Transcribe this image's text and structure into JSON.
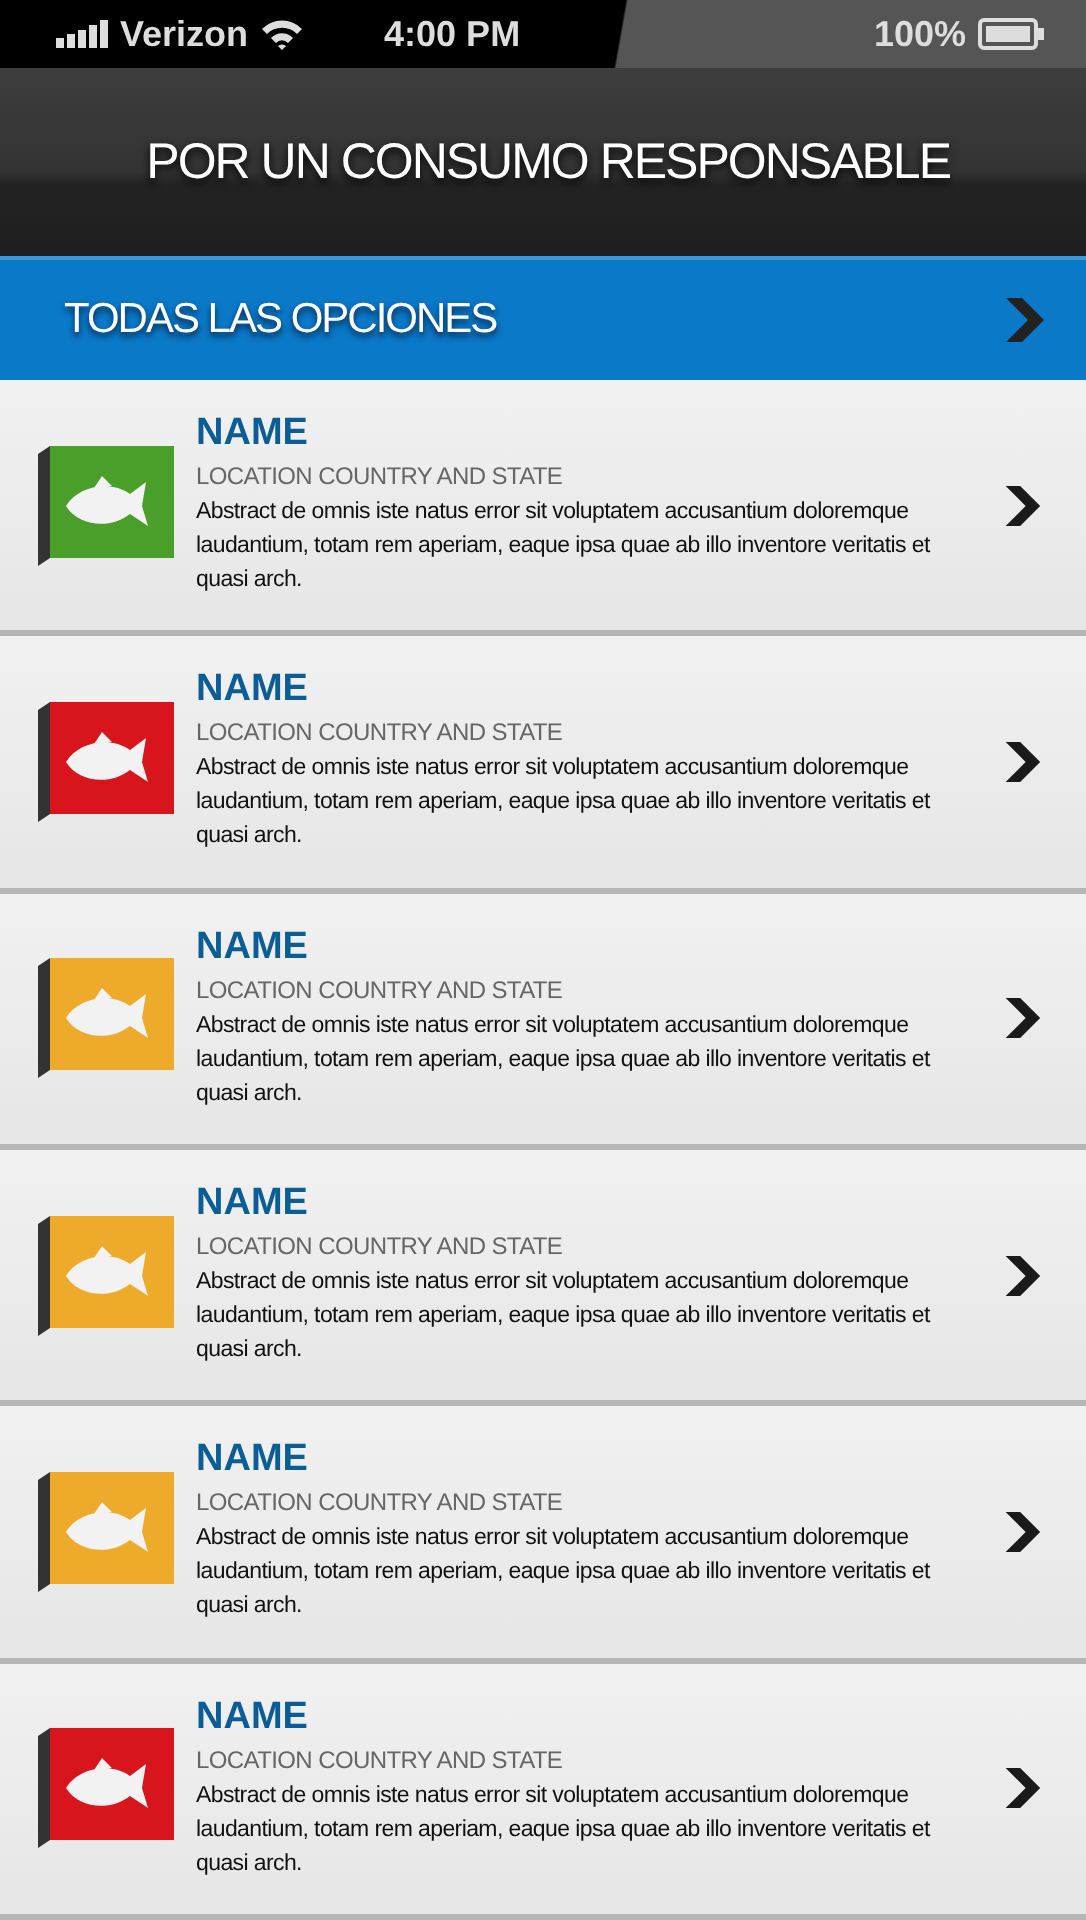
{
  "status_bar": {
    "carrier": "Verizon",
    "time": "4:00 PM",
    "battery": "100%"
  },
  "header": {
    "title": "POR UN CONSUMO RESPONSABLE"
  },
  "all_options": {
    "label": "TODAS LAS OPCIONES"
  },
  "items": [
    {
      "name": "NAME",
      "location": "LOCATION COUNTRY AND STATE",
      "description": "Abstract de omnis iste natus error sit voluptatem accusantium doloremque laudantium, totam rem aperiam, eaque ipsa quae ab illo inventore veritatis et quasi arch.",
      "color": "#4a9e2a"
    },
    {
      "name": "NAME",
      "location": "LOCATION COUNTRY AND STATE",
      "description": "Abstract de omnis iste natus error sit voluptatem accusantium doloremque laudantium, totam rem aperiam, eaque ipsa quae ab illo inventore veritatis et quasi arch.",
      "color": "#d8141c"
    },
    {
      "name": "NAME",
      "location": "LOCATION COUNTRY AND STATE",
      "description": "Abstract de omnis iste natus error sit voluptatem accusantium doloremque laudantium, totam rem aperiam, eaque ipsa quae ab illo inventore veritatis et quasi arch.",
      "color": "#eeaa2a"
    },
    {
      "name": "NAME",
      "location": "LOCATION COUNTRY AND STATE",
      "description": "Abstract de omnis iste natus error sit voluptatem accusantium doloremque laudantium, totam rem aperiam, eaque ipsa quae ab illo inventore veritatis et quasi arch.",
      "color": "#eeaa2a"
    },
    {
      "name": "NAME",
      "location": "LOCATION COUNTRY AND STATE",
      "description": "Abstract de omnis iste natus error sit voluptatem accusantium doloremque laudantium, totam rem aperiam, eaque ipsa quae ab illo inventore veritatis et quasi arch.",
      "color": "#eeaa2a"
    },
    {
      "name": "NAME",
      "location": "LOCATION COUNTRY AND STATE",
      "description": "Abstract de omnis iste natus error sit voluptatem accusantium doloremque laudantium, totam rem aperiam, eaque ipsa quae ab illo inventore veritatis et quasi arch.",
      "color": "#d8141c"
    }
  ]
}
